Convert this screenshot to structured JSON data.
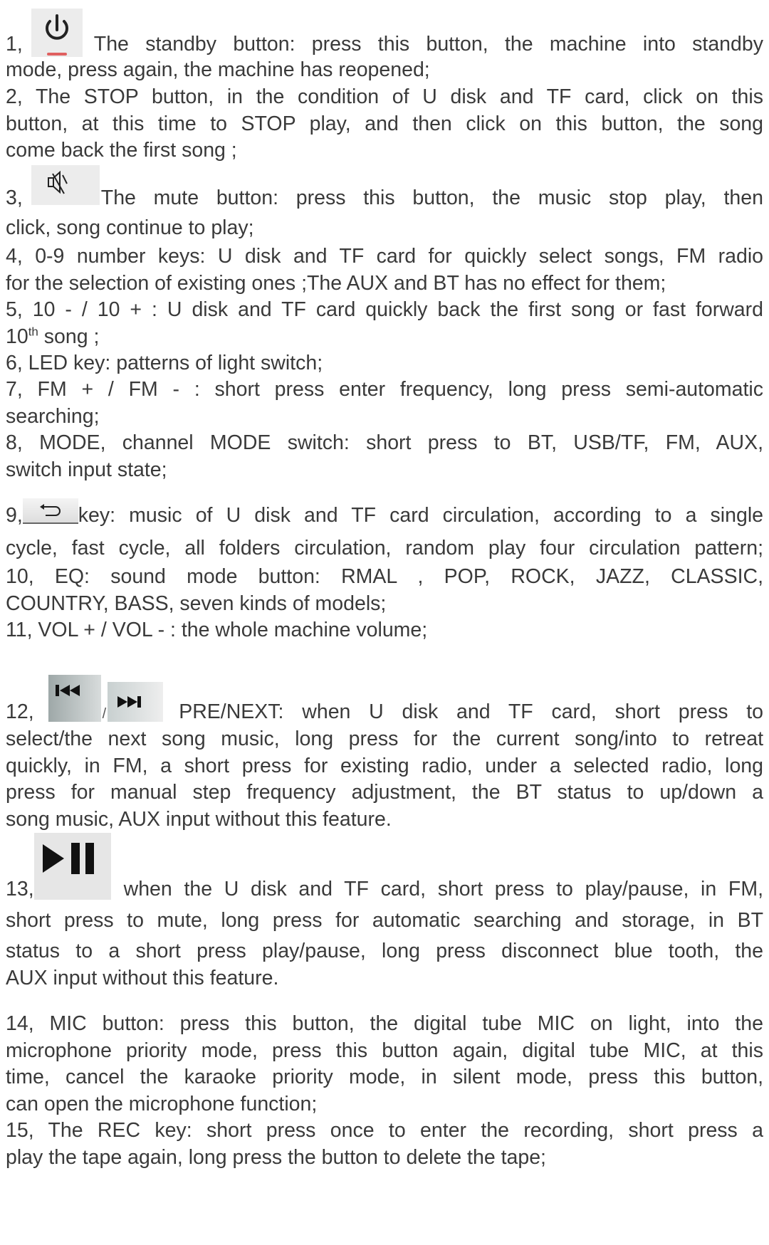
{
  "items": [
    {
      "num": "1,",
      "icon": "power-icon",
      "lines": [
        "The standby button: press this button, the machine into standby",
        "mode, press again, the machine has reopened;"
      ]
    },
    {
      "lines": [
        "2, The STOP button, in the condition of U disk and TF card, click on this",
        "button, at this time to STOP play, and then click on this button, the song",
        "come back the first song ;"
      ]
    },
    {
      "num": "3,",
      "icon": "mute-icon",
      "lines": [
        "The mute button: press this button, the music stop play, then",
        "click, song continue to play;"
      ]
    },
    {
      "lines": [
        "4, 0-9 number keys: U disk and TF card for quickly select songs, FM radio",
        "for the selection of existing ones ;The AUX and BT has no effect for them;"
      ]
    },
    {
      "lines": [
        "5, 10 - / 10 + : U disk and TF card quickly back the first song or fast forward"
      ],
      "line2_pre": "10",
      "line2_sup": "th",
      "line2_post": " song ;"
    },
    {
      "lines": [
        "6, LED key: patterns of light switch;"
      ]
    },
    {
      "lines": [
        "7, FM + / FM - : short press enter frequency, long press semi-automatic",
        "searching;"
      ]
    },
    {
      "lines": [
        "8, MODE, channel MODE switch: short press to BT, USB/TF, FM, AUX,",
        "switch input state;"
      ]
    },
    {
      "num": "9,",
      "icon": "repeat-icon",
      "lines": [
        "key: music of U disk and TF card circulation, according to a single",
        "cycle, fast cycle, all folders circulation, random play four circulation pattern;"
      ]
    },
    {
      "lines": [
        "10, EQ: sound mode button: RMAL , POP, ROCK, JAZZ, CLASSIC,",
        "COUNTRY, BASS, seven kinds of models;"
      ]
    },
    {
      "lines": [
        "11, VOL + / VOL - : the whole machine volume;"
      ]
    },
    {
      "num": "12,",
      "icon": "prev-next-icons",
      "sep": "/",
      "lines": [
        "PRE/NEXT: when U disk and TF card, short press to",
        "select/the next song music, long press for the current song/into to retreat",
        "quickly, in FM, a short press for existing radio, under a selected radio, long",
        "press for manual step frequency adjustment, the BT status to up/down a",
        "song music, AUX input without this feature."
      ]
    },
    {
      "num": "13,",
      "icon": "play-pause-icon",
      "lines": [
        "when the U disk and TF card, short press to play/pause, in FM,",
        "short press to mute, long press for automatic searching and storage, in BT",
        "status to a short press play/pause, long press disconnect blue tooth, the",
        "AUX input without this feature."
      ]
    },
    {
      "lines": [
        "14, MIC button: press this button, the digital tube MIC on light, into the",
        "microphone priority mode, press this button again, digital tube MIC, at this",
        "time, cancel the karaoke priority mode, in silent mode, press this button,",
        "can open the microphone function;"
      ]
    },
    {
      "lines": [
        "15, The REC key: short press once to enter the recording, short press a",
        "play the tape again, long press the button to delete the tape;"
      ]
    }
  ]
}
